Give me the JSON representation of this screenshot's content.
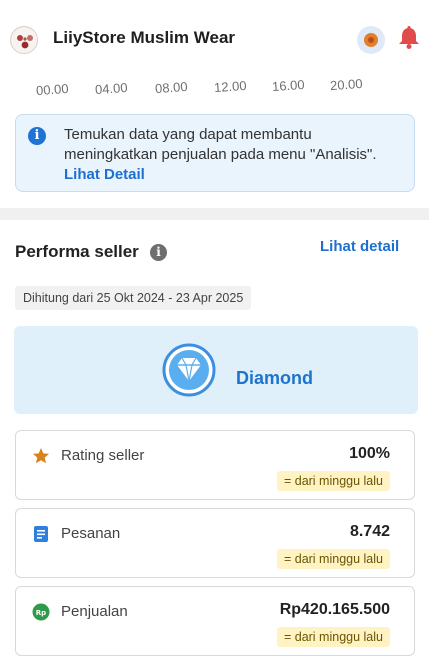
{
  "header": {
    "store_name": "LiiyStore Muslim Wear",
    "accent_color": "#1e6fd0"
  },
  "time_axis": {
    "ticks": [
      "00.00",
      "04.00",
      "08.00",
      "12.00",
      "16.00",
      "20.00"
    ]
  },
  "info_banner": {
    "text": "Temukan data yang dapat membantu meningkatkan penjualan pada menu \"Analisis\". ",
    "link_label": "Lihat Detail"
  },
  "performance": {
    "title": "Performa seller",
    "detail_link": "Lihat detail",
    "date_range": "Dihitung dari 25 Okt 2024 - 23 Apr 2025",
    "tier_label": "Diamond"
  },
  "metrics": [
    {
      "icon": "star-icon",
      "label": "Rating seller",
      "value": "100%",
      "change": "= dari minggu lalu"
    },
    {
      "icon": "orders-icon",
      "label": "Pesanan",
      "value": "8.742",
      "change": "= dari minggu lalu"
    },
    {
      "icon": "rupiah-icon",
      "label": "Penjualan",
      "value": "Rp420.165.500",
      "change": "= dari minggu lalu"
    }
  ]
}
